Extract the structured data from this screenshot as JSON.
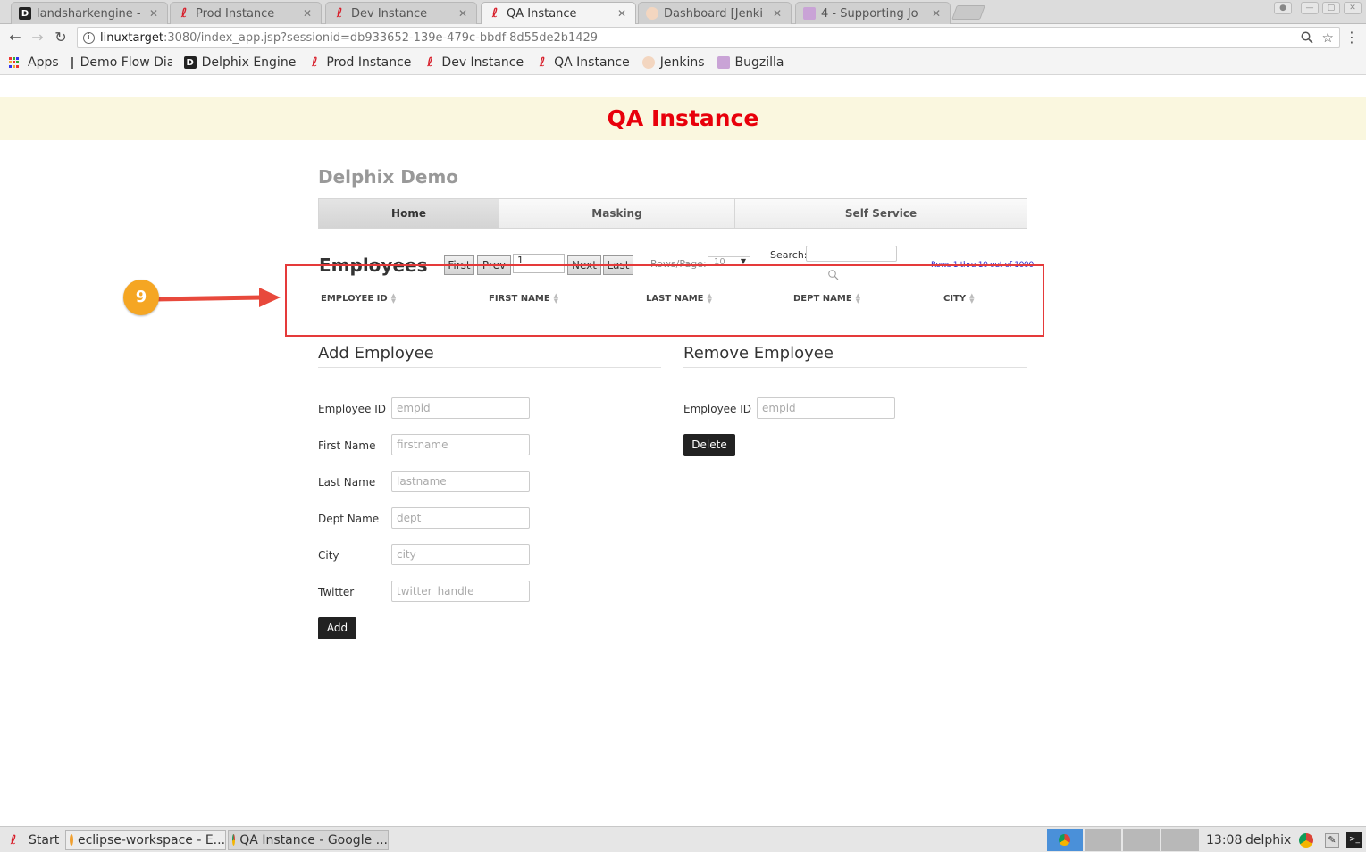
{
  "browser": {
    "tabs": [
      {
        "title": "landsharkengine -",
        "icon": "delphix-d-icon"
      },
      {
        "title": "Prod Instance",
        "icon": "delphix-icon"
      },
      {
        "title": "Dev Instance",
        "icon": "delphix-icon"
      },
      {
        "title": "QA Instance",
        "icon": "delphix-icon"
      },
      {
        "title": "Dashboard [Jenki",
        "icon": "jenkins-icon"
      },
      {
        "title": "4 - Supporting Jo",
        "icon": "bugzilla-icon"
      }
    ],
    "url_host": "linuxtarget",
    "url_rest": ":3080/index_app.jsp?sessionid=db933652-139e-479c-bbdf-8d55de2b1429",
    "bookmarks": [
      {
        "label": "Apps",
        "icon": "apps-grid-icon"
      },
      {
        "label": "Demo Flow Dia",
        "icon": "page-icon"
      },
      {
        "label": "Delphix Engine",
        "icon": "delphix-d-icon"
      },
      {
        "label": "Prod Instance",
        "icon": "delphix-icon"
      },
      {
        "label": "Dev Instance",
        "icon": "delphix-icon"
      },
      {
        "label": "QA Instance",
        "icon": "delphix-icon"
      },
      {
        "label": "Jenkins",
        "icon": "jenkins-icon"
      },
      {
        "label": "Bugzilla",
        "icon": "bugzilla-icon"
      }
    ]
  },
  "page": {
    "banner": "QA Instance",
    "title": "Delphix Demo",
    "nav": [
      "Home",
      "Masking",
      "Self Service"
    ],
    "employees": {
      "heading": "Employees",
      "first": "First",
      "prev": "Prev",
      "page_value": "1",
      "next": "Next",
      "last": "Last",
      "rows_label": "Rows/Page:",
      "rows_value": "10",
      "search_label": "Search:",
      "rows_info": "Rows 1 thru 10 out of 1000",
      "columns": [
        "EMPLOYEE ID",
        "FIRST NAME",
        "LAST NAME",
        "DEPT NAME",
        "CITY"
      ]
    },
    "callout_number": "9",
    "add": {
      "title": "Add Employee",
      "fields": [
        {
          "label": "Employee ID",
          "placeholder": "empid"
        },
        {
          "label": "First Name",
          "placeholder": "firstname"
        },
        {
          "label": "Last Name",
          "placeholder": "lastname"
        },
        {
          "label": "Dept Name",
          "placeholder": "dept"
        },
        {
          "label": "City",
          "placeholder": "city"
        },
        {
          "label": "Twitter",
          "placeholder": "twitter_handle"
        }
      ],
      "button": "Add"
    },
    "remove": {
      "title": "Remove Employee",
      "field_label": "Employee ID",
      "field_placeholder": "empid",
      "button": "Delete"
    }
  },
  "taskbar": {
    "start": "Start",
    "tasks": [
      "eclipse-workspace - E...",
      "QA Instance - Google ..."
    ],
    "clock": "13:08",
    "user": "delphix"
  },
  "colors": {
    "accent_red": "#e8000b",
    "callout": "#f5a623",
    "highlight": "#e53a3a",
    "link_blue": "#2a24c9"
  }
}
